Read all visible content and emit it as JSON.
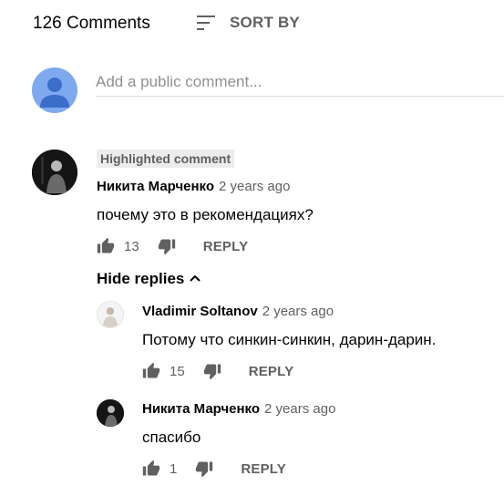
{
  "header": {
    "comment_count": "126 Comments",
    "sort_label": "SORT BY"
  },
  "new_comment": {
    "placeholder": "Add a public comment..."
  },
  "highlighted_label": "Highlighted comment",
  "comments": [
    {
      "author": "Никита Марченко",
      "time": "2 years ago",
      "text": "почему это в рекомендациях?",
      "likes": "13",
      "reply_label": "REPLY"
    }
  ],
  "replies_toggle": "Hide replies",
  "replies": [
    {
      "author": "Vladimir Soltanov",
      "time": "2 years ago",
      "text": "Потому что синкин-синкин, дарин-дарин.",
      "likes": "15",
      "reply_label": "REPLY"
    },
    {
      "author": "Никита Марченко",
      "time": "2 years ago",
      "text": "спасибо",
      "likes": "1",
      "reply_label": "REPLY"
    }
  ],
  "colors": {
    "secondary_text": "#606060",
    "primary_text": "#030303",
    "user_avatar": "#7fa9ef"
  }
}
